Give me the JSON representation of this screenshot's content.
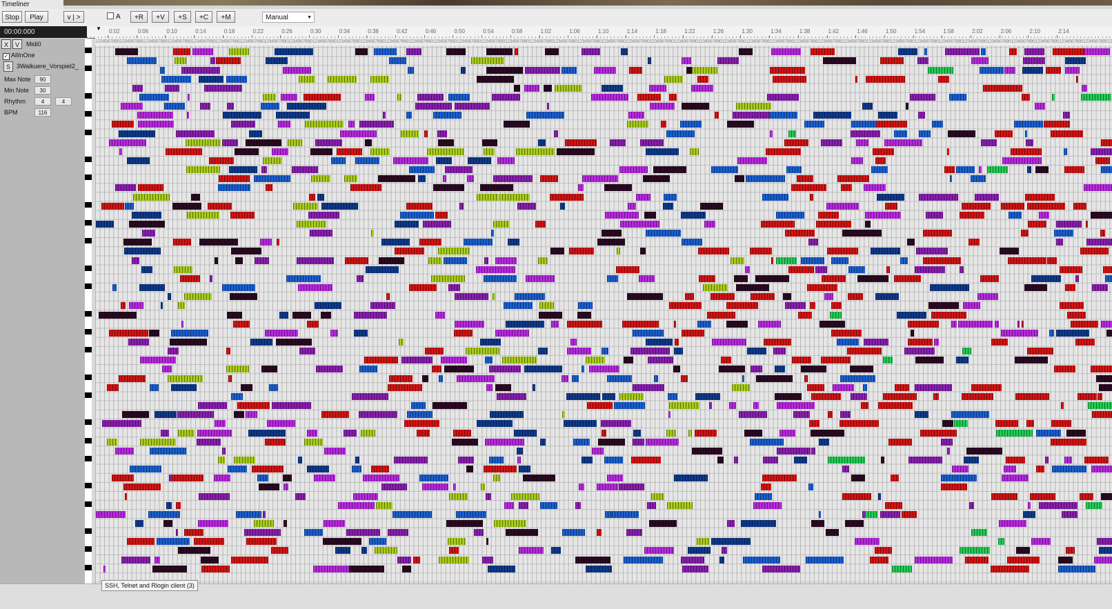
{
  "window": {
    "title": "Timeliner"
  },
  "toolbar": {
    "stop_label": "Stop",
    "play_label": "Play",
    "view_label": "v | >",
    "checkbox_a_label": "A",
    "add_r_label": "+R",
    "add_v_label": "+V",
    "add_s_label": "+S",
    "add_c_label": "+C",
    "add_m_label": "+M",
    "mode_value": "Manual"
  },
  "time_display": "00:00:000",
  "ruler": {
    "labels": [
      "0:02",
      "0:06",
      "0:10",
      "0:14",
      "0:18",
      "0:22",
      "0:26",
      "0:30",
      "0:34",
      "0:38",
      "0:42",
      "0:46",
      "0:50",
      "0:54",
      "0:58",
      "1:02",
      "1:06",
      "1:10",
      "1:14",
      "1:18",
      "1:22",
      "1:26",
      "1:30",
      "1:34",
      "1:38",
      "1:42",
      "1:46",
      "1:50",
      "1:54",
      "1:58",
      "2:02",
      "2:06",
      "2:10",
      "2:14"
    ]
  },
  "left_panel": {
    "x_button": "X",
    "v_button": "V",
    "track_name": "Midi0",
    "all_in_one_label": "AllInOne",
    "all_in_one_checked": true,
    "s_button": "S",
    "file_name": "3Walkuere_Vorspiel2_",
    "max_note_label": "Max Note",
    "max_note_value": "90",
    "min_note_label": "Min Note",
    "min_note_value": "30",
    "rhythm_label": "Rhythm",
    "rhythm_num": "4",
    "rhythm_den": "4",
    "bpm_label": "BPM",
    "bpm_value": "116"
  },
  "colors": {
    "magenta": "#b829e0",
    "purple": "#8a1fb0",
    "dark": "#2a0a22",
    "red": "#d41414",
    "blue": "#1a5fd0",
    "navy": "#0f3a8c",
    "green": "#22cc55",
    "lime": "#a8cc1a"
  },
  "taskbar": {
    "item_label": "SSH, Telnet and Rlogin client (3)"
  }
}
